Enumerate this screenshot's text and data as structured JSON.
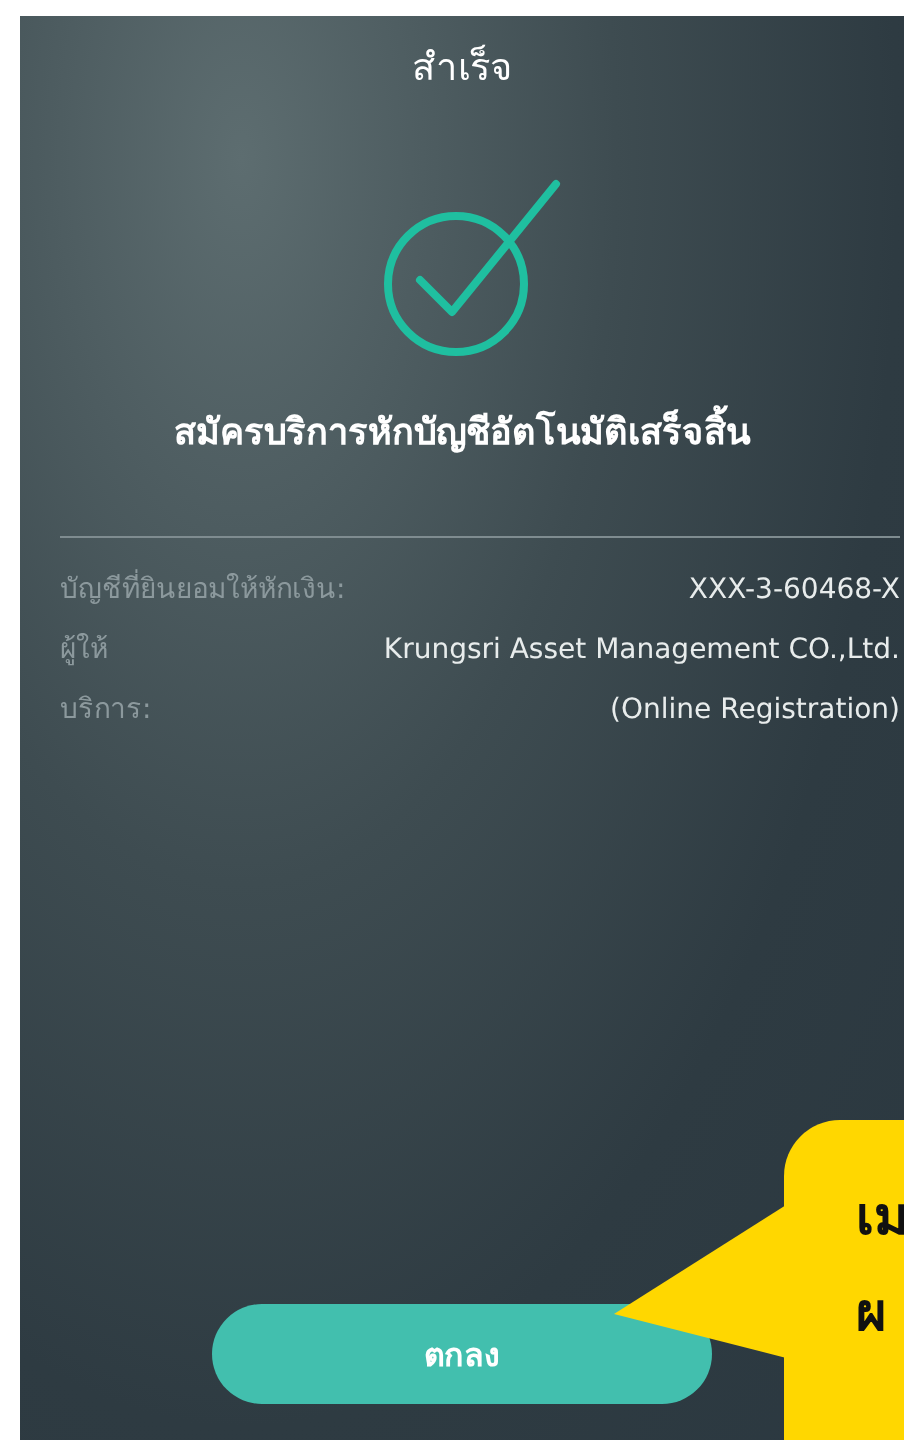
{
  "screen": {
    "title": "สำเร็จ",
    "heading": "สมัครบริการหักบัญชีอัตโนมัติเสร็จสิ้น",
    "details": [
      {
        "label": "บัญชีที่ยินยอมให้หักเงิน:",
        "value": "XXX-3-60468-X"
      },
      {
        "label": "ผู้ให้",
        "value": "Krungsri Asset Management CO.,Ltd."
      },
      {
        "label": "บริการ:",
        "value": "(Online Registration)"
      }
    ],
    "button": "ตกลง"
  },
  "callout": {
    "lines": [
      "เม",
      "ผ"
    ]
  }
}
